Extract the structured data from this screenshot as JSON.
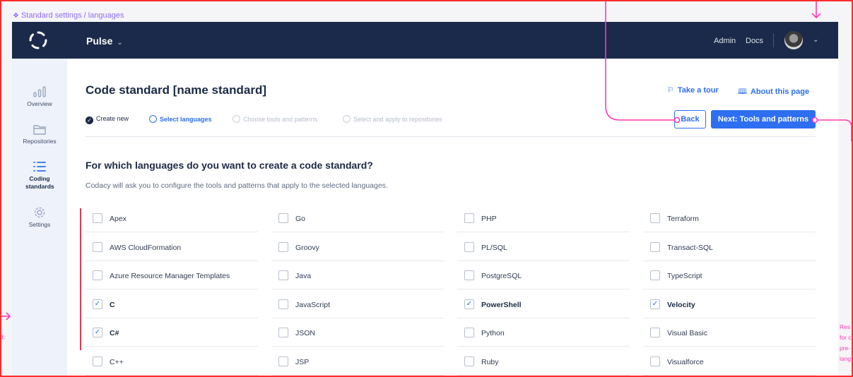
{
  "frame": {
    "caption": "Standard settings / languages"
  },
  "topbar": {
    "product": "Pulse",
    "links": [
      "Admin",
      "Docs"
    ]
  },
  "sidebar": {
    "items": [
      {
        "label": "Overview",
        "icon": "chart-bars-icon"
      },
      {
        "label": "Repositories",
        "icon": "folder-icon"
      },
      {
        "label": "Coding standards",
        "icon": "list-icon",
        "active": true
      },
      {
        "label": "Settings",
        "icon": "gear-icon"
      }
    ]
  },
  "page": {
    "title": "Code standard [name standard]",
    "take_tour": "Take a tour",
    "about": "About this page",
    "back": "Back",
    "next": "Next: Tools and patterns"
  },
  "steps": [
    {
      "label": "Create new",
      "state": "done"
    },
    {
      "label": "Select languages",
      "state": "current"
    },
    {
      "label": "Choose tools and patterns",
      "state": "todo"
    },
    {
      "label": "Select and apply to repositories",
      "state": "todo"
    }
  ],
  "content": {
    "question": "For which languages do you want to create a code standard?",
    "subtitle": "Codacy will ask you to configure the tools and patterns that apply to the selected languages."
  },
  "languages": [
    [
      {
        "name": "Apex",
        "checked": false
      },
      {
        "name": "AWS CloudFormation",
        "checked": false
      },
      {
        "name": "Azure Resource Manager Templates",
        "checked": false
      },
      {
        "name": "C",
        "checked": true
      },
      {
        "name": "C#",
        "checked": true
      },
      {
        "name": "C++",
        "checked": false
      }
    ],
    [
      {
        "name": "Go",
        "checked": false
      },
      {
        "name": "Groovy",
        "checked": false
      },
      {
        "name": "Java",
        "checked": false
      },
      {
        "name": "JavaScript",
        "checked": false
      },
      {
        "name": "JSON",
        "checked": false
      },
      {
        "name": "JSP",
        "checked": false
      }
    ],
    [
      {
        "name": "PHP",
        "checked": false
      },
      {
        "name": "PL/SQL",
        "checked": false
      },
      {
        "name": "PostgreSQL",
        "checked": false
      },
      {
        "name": "PowerShell",
        "checked": true
      },
      {
        "name": "Python",
        "checked": false
      },
      {
        "name": "Ruby",
        "checked": false
      }
    ],
    [
      {
        "name": "Terraform",
        "checked": false
      },
      {
        "name": "Transact-SQL",
        "checked": false
      },
      {
        "name": "TypeScript",
        "checked": false
      },
      {
        "name": "Velocity",
        "checked": true
      },
      {
        "name": "Visual Basic",
        "checked": false
      },
      {
        "name": "Visualforce",
        "checked": false
      }
    ]
  ],
  "annotations": {
    "right_note_lines": [
      "Res",
      "for c",
      "pre-",
      "lang"
    ],
    "left_note": "d;"
  },
  "colors": {
    "topbar": "#1b2a4a",
    "accent": "#2d6ff0",
    "annotation": "#ff38b8",
    "frame": "#ff2d2d"
  }
}
